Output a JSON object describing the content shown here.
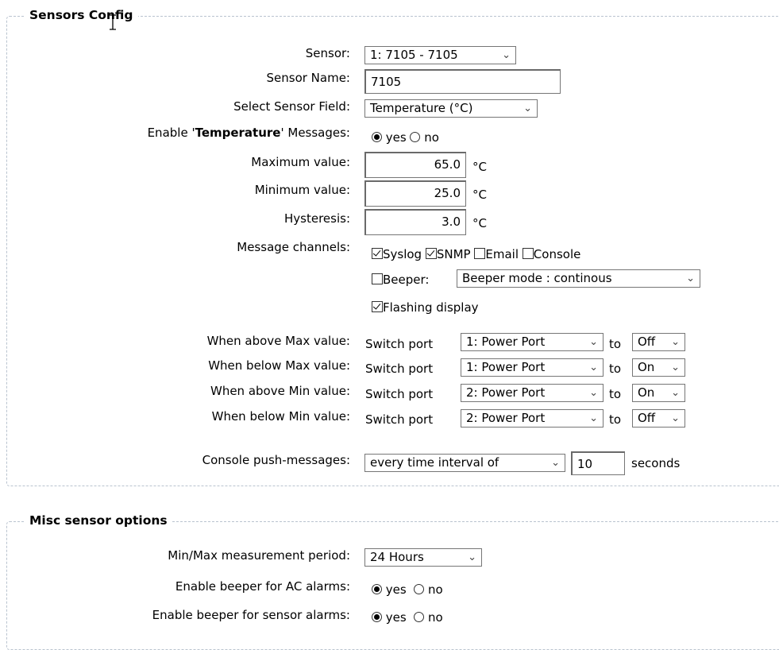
{
  "sensors_config": {
    "title": "Sensors Config",
    "sensor_label": "Sensor:",
    "sensor_value": "1: 7105 - 7105",
    "sensor_name_label": "Sensor Name:",
    "sensor_name_value": "7105",
    "field_label": "Select Sensor Field:",
    "field_value": "Temperature (°C)",
    "enable_prefix": "Enable '",
    "enable_bold": "Temperature",
    "enable_suffix": "' Messages:",
    "yes": "yes",
    "no": "no",
    "enable_selected": "yes",
    "max_label": "Maximum value:",
    "max_value": "65.0",
    "min_label": "Minimum value:",
    "min_value": "25.0",
    "hyst_label": "Hysteresis:",
    "hyst_value": "3.0",
    "unit": "°C",
    "channels_label": "Message channels:",
    "ch_syslog": "Syslog",
    "ch_snmp": "SNMP",
    "ch_email": "Email",
    "ch_console": "Console",
    "ch_beeper": "Beeper:",
    "beeper_mode": "Beeper mode : continous",
    "ch_flashing": "Flashing display",
    "channels_checked": {
      "syslog": true,
      "snmp": true,
      "email": false,
      "console": false,
      "beeper": false,
      "flashing": true
    },
    "switch_text": "Switch port",
    "to_text": "to",
    "rules": [
      {
        "label": "When above Max value:",
        "port": "1: Power Port",
        "state": "Off"
      },
      {
        "label": "When below Max value:",
        "port": "1: Power Port",
        "state": "On"
      },
      {
        "label": "When above Min value:",
        "port": "2: Power Port",
        "state": "On"
      },
      {
        "label": "When below Min value:",
        "port": "2: Power Port",
        "state": "Off"
      }
    ],
    "push_label": "Console push-messages:",
    "push_mode": "every time interval of",
    "push_interval": "10",
    "push_unit": "seconds"
  },
  "misc_options": {
    "title": "Misc sensor options",
    "period_label": "Min/Max measurement period:",
    "period_value": "24 Hours",
    "ac_label": "Enable beeper for AC alarms:",
    "ac_selected": "yes",
    "sensor_alarm_label": "Enable beeper for sensor alarms:",
    "sensor_alarm_selected": "yes",
    "yes": "yes",
    "no": "no"
  },
  "icons": {
    "chevron": "chevron-down-icon",
    "cursor": "text-cursor-icon"
  }
}
